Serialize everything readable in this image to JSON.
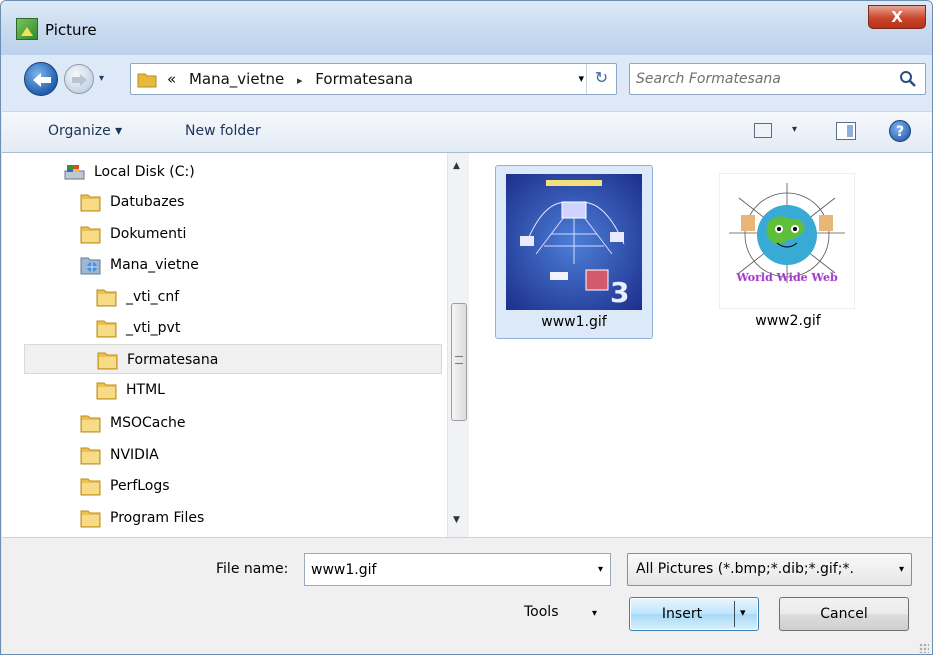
{
  "window": {
    "title": "Picture",
    "close_symbol": "X"
  },
  "nav": {
    "back_icon": "back-arrow-icon",
    "forward_icon": "forward-arrow-icon",
    "history_dropdown": "▾"
  },
  "address": {
    "prefix": "«",
    "segments": [
      "Mana_vietne",
      "Formatesana"
    ],
    "separator": "▸",
    "dropdown": "▾",
    "refresh_symbol": "↻"
  },
  "search": {
    "placeholder": "Search Formatesana",
    "value": ""
  },
  "toolbar": {
    "organize_label": "Organize ▾",
    "new_folder_label": "New folder",
    "view_dropdown": "▾",
    "help_symbol": "?"
  },
  "tree": {
    "items": [
      {
        "label": "Local Disk (C:)",
        "icon": "drive-icon"
      },
      {
        "label": "Datubazes",
        "icon": "folder-icon"
      },
      {
        "label": "Dokumenti",
        "icon": "folder-icon"
      },
      {
        "label": "Mana_vietne",
        "icon": "web-folder-icon"
      },
      {
        "label": "_vti_cnf",
        "icon": "folder-icon"
      },
      {
        "label": "_vti_pvt",
        "icon": "folder-icon"
      },
      {
        "label": "Formatesana",
        "icon": "folder-icon",
        "selected": true
      },
      {
        "label": "HTML",
        "icon": "folder-icon"
      },
      {
        "label": "MSOCache",
        "icon": "folder-icon"
      },
      {
        "label": "NVIDIA",
        "icon": "folder-icon"
      },
      {
        "label": "PerfLogs",
        "icon": "folder-icon"
      },
      {
        "label": "Program Files",
        "icon": "folder-icon"
      }
    ],
    "scroll_up": "▲",
    "scroll_down": "▼"
  },
  "files": [
    {
      "name": "www1.gif",
      "selected": true,
      "thumb_caption": "",
      "thumb_number": "3"
    },
    {
      "name": "www2.gif",
      "selected": false,
      "thumb_caption": "World Wide Web"
    }
  ],
  "bottom": {
    "filename_label": "File name:",
    "filename_value": "www1.gif",
    "filename_dropdown": "▾",
    "filter_value": "All Pictures (*.bmp;*.dib;*.gif;*.",
    "filter_dropdown": "▾",
    "tools_label": "Tools",
    "tools_dropdown": "▾",
    "insert_label": "Insert",
    "insert_dropdown": "▾",
    "cancel_label": "Cancel"
  },
  "colors": {
    "window_frame": "#dde9f6",
    "selection": "#dce9f8",
    "close_red": "#c9462c"
  }
}
